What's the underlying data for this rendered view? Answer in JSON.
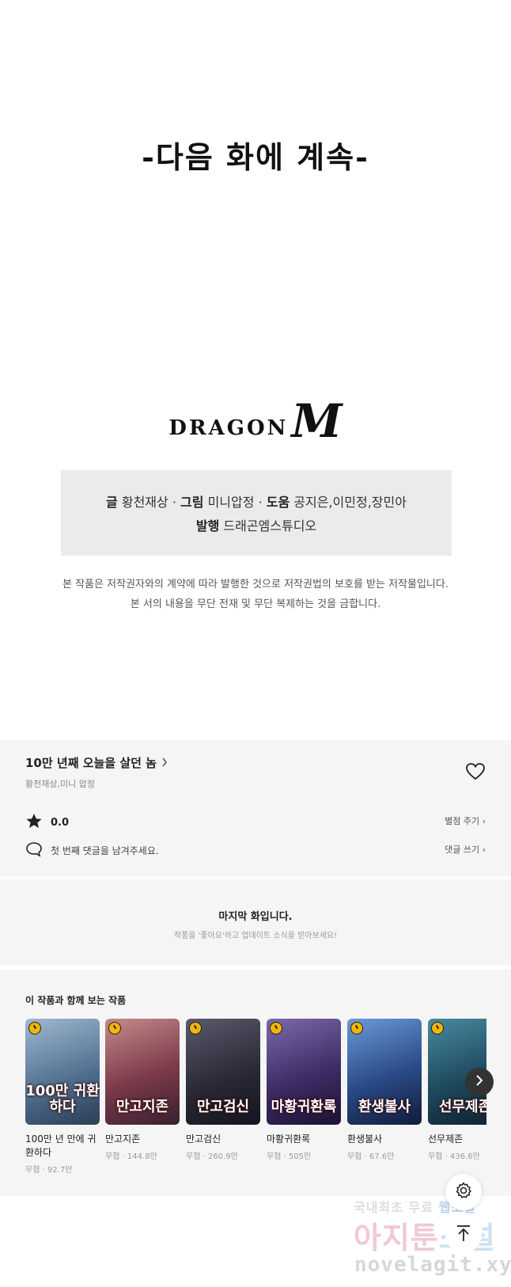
{
  "episode_end": {
    "continue_text": "-다음 화에 계속-",
    "logo_text": "DRAGON",
    "logo_letter": "M"
  },
  "credits": {
    "writer_label": "글",
    "writer": "황천재상",
    "art_label": "그림",
    "art": "미니압정",
    "assist_label": "도움",
    "assist": "공지은,이민정,장민아",
    "publisher_label": "발행",
    "publisher": "드래곤엠스튜디오",
    "separator": "·"
  },
  "copyright": {
    "line1": "본 작품은 저작권자와의 계약에 따라 발행한 것으로 저작권법의 보호를 받는 저작물입니다.",
    "line2": "본 서의 내용을 무단 전재 및 무단 복제하는 것을 금합니다."
  },
  "work_info": {
    "title": "10만 년째 오늘을 살던 놈",
    "authors": "황천재상,미니 압정",
    "rating": "0.0",
    "rate_link": "별점 주기 ›",
    "comment_prompt": "첫 번째 댓글을 남겨주세요.",
    "comment_link": "댓글 쓰기 ›",
    "icons": {
      "heart": "heart-icon",
      "star": "star-icon",
      "comment": "comment-icon"
    }
  },
  "last_episode": {
    "title": "마지막 화입니다.",
    "subtitle": "작품을 '좋아요'하고 업데이트 소식을 받아보세요!"
  },
  "recommendations": {
    "heading": "이 작품과 함께 보는 작품",
    "items": [
      {
        "name": "100만 년 만에 귀환하다",
        "meta": "무협 · 92.7만",
        "thumb_title": "100만 귀환하다",
        "bg": "#6a8fb0"
      },
      {
        "name": "만고지존",
        "meta": "무협 · 144.8만",
        "thumb_title": "만고지존",
        "bg": "#8a4a5a"
      },
      {
        "name": "만고검신",
        "meta": "무협 · 260.9만",
        "thumb_title": "만고검신",
        "bg": "#3a3a4a"
      },
      {
        "name": "마황귀환록",
        "meta": "무협 · 505만",
        "thumb_title": "마황귀환록",
        "bg": "#4a3a6a"
      },
      {
        "name": "환생불사",
        "meta": "무협 · 67.6만",
        "thumb_title": "환생불사",
        "bg": "#2a4a7a"
      },
      {
        "name": "선무제존",
        "meta": "무협 · 436.6만",
        "thumb_title": "선무제존",
        "bg": "#2a5a6a"
      }
    ]
  },
  "watermark": {
    "line1_a": "국내최초 무료 ",
    "line1_b": "웹소설",
    "line2_a": "아지툰",
    "line2_b": "소설",
    "line3": "novelagit.xyz"
  }
}
